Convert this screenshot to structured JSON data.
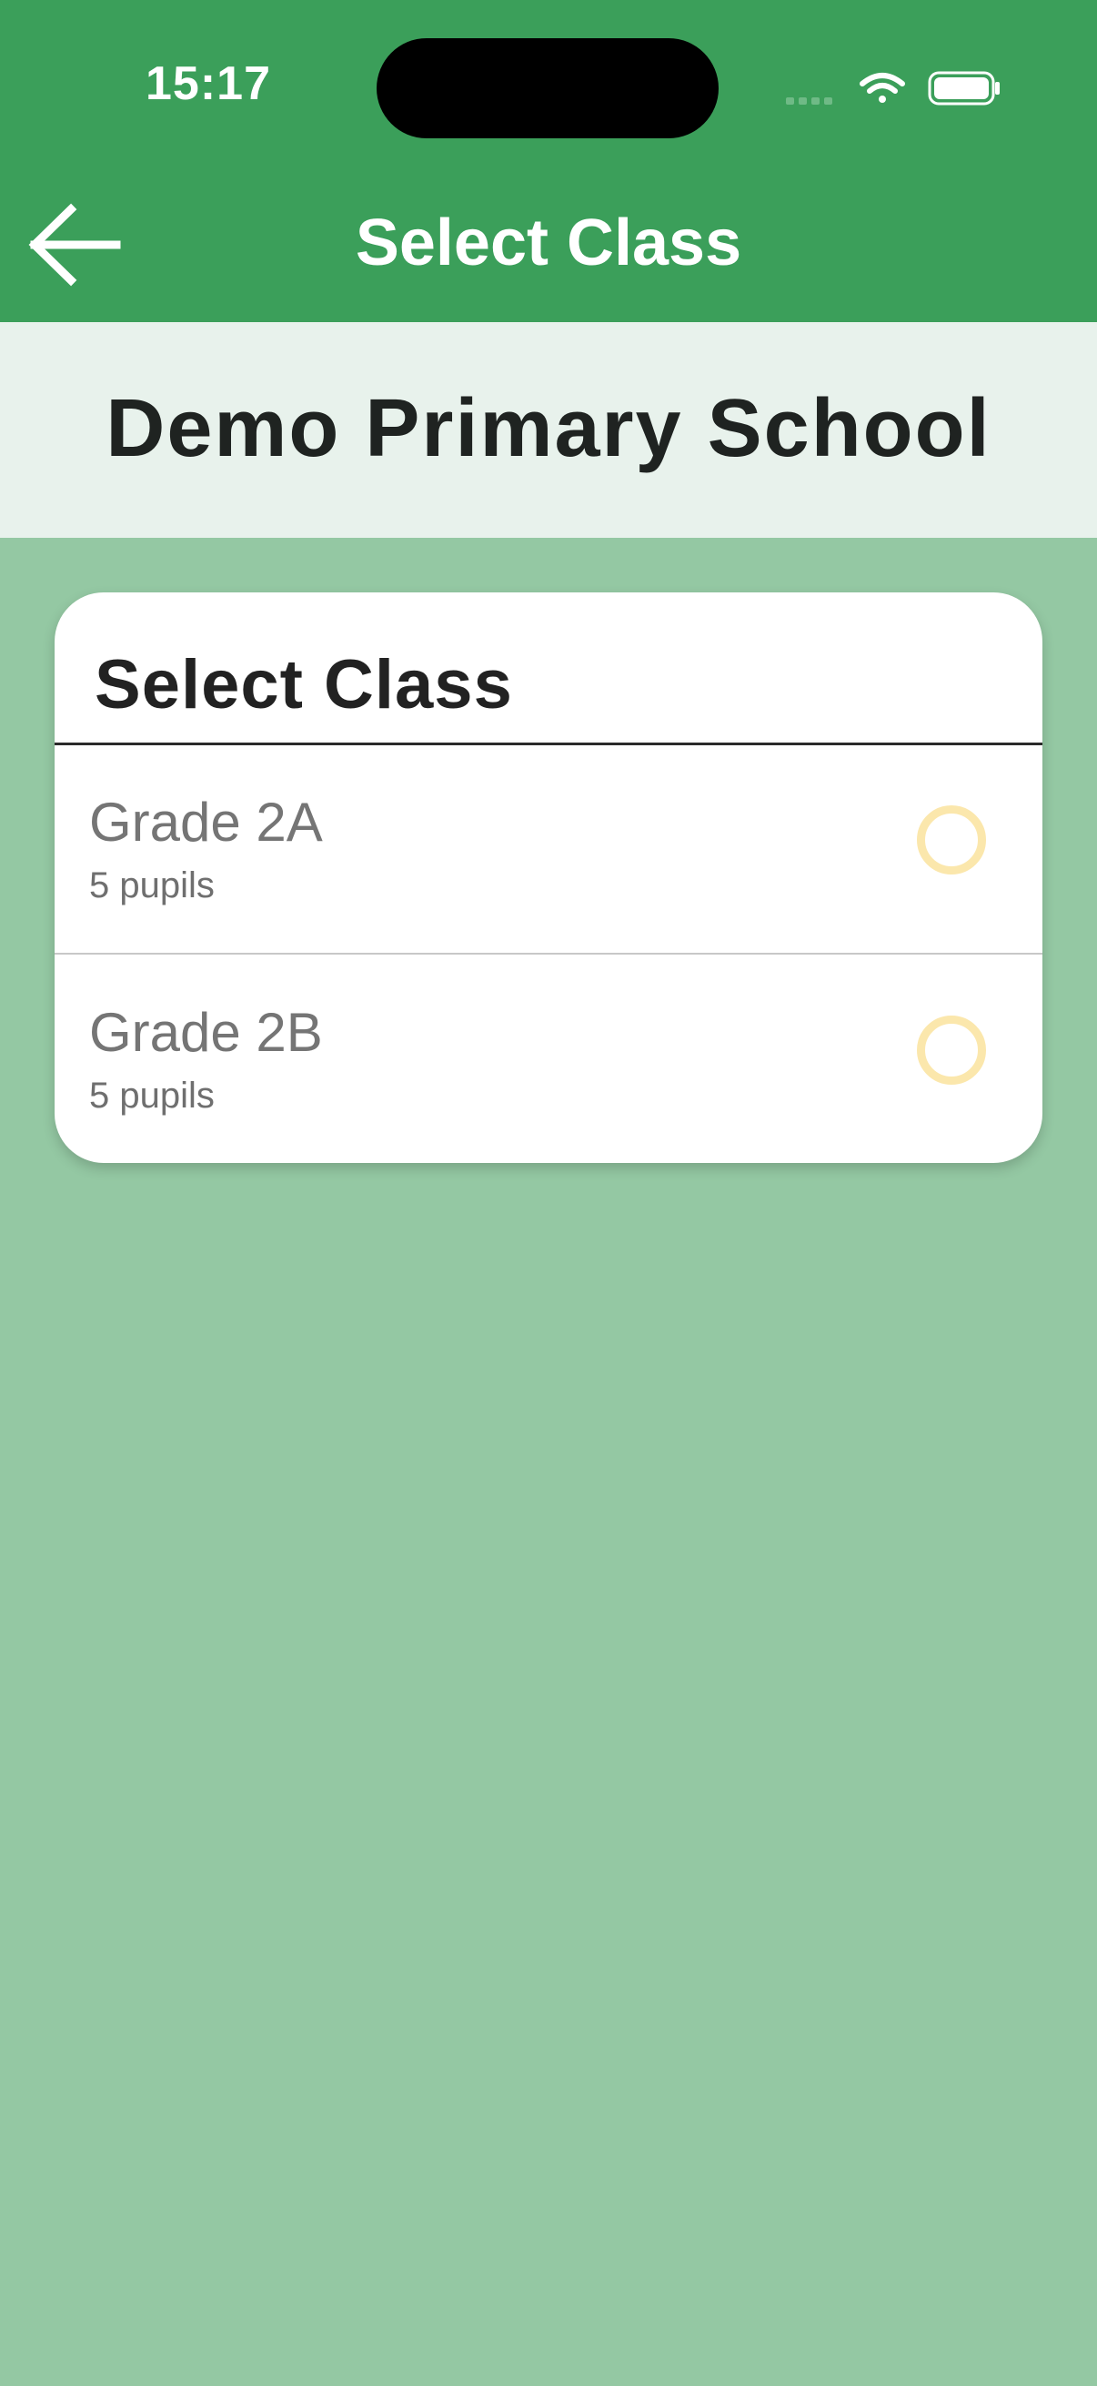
{
  "status_bar": {
    "time": "15:17"
  },
  "nav": {
    "title": "Select Class"
  },
  "school": {
    "name": "Demo Primary School"
  },
  "card": {
    "title": "Select Class",
    "classes": [
      {
        "name": "Grade 2A",
        "count": "5 pupils",
        "selected": false
      },
      {
        "name": "Grade 2B",
        "count": "5 pupils",
        "selected": false
      }
    ]
  },
  "icons": {
    "back": "arrow-left-icon",
    "signal": "cellular-signal-icon",
    "wifi": "wifi-icon",
    "battery": "battery-icon",
    "radio": "radio-unselected-icon"
  },
  "colors": {
    "header_green": "#3b9f5a",
    "background_green": "#94c8a3",
    "banner": "#e8f2ec",
    "radio_outline": "#fbe7ac"
  }
}
